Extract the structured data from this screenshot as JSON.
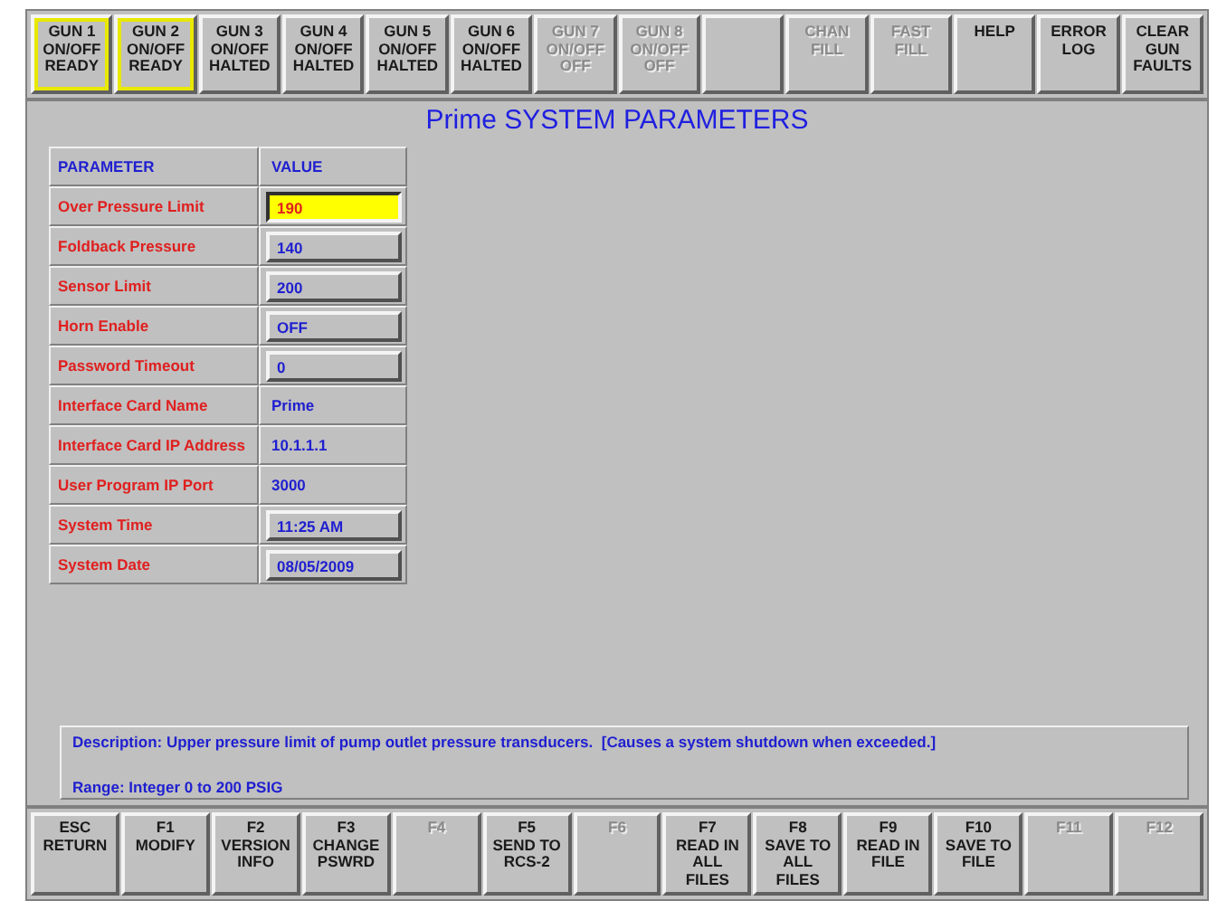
{
  "top_buttons": [
    {
      "lines": [
        "GUN 1",
        "ON/OFF",
        "READY"
      ],
      "highlighted": true,
      "disabled": false
    },
    {
      "lines": [
        "GUN 2",
        "ON/OFF",
        "READY"
      ],
      "highlighted": true,
      "disabled": false
    },
    {
      "lines": [
        "GUN 3",
        "ON/OFF",
        "HALTED"
      ],
      "highlighted": false,
      "disabled": false
    },
    {
      "lines": [
        "GUN 4",
        "ON/OFF",
        "HALTED"
      ],
      "highlighted": false,
      "disabled": false
    },
    {
      "lines": [
        "GUN 5",
        "ON/OFF",
        "HALTED"
      ],
      "highlighted": false,
      "disabled": false
    },
    {
      "lines": [
        "GUN 6",
        "ON/OFF",
        "HALTED"
      ],
      "highlighted": false,
      "disabled": false
    },
    {
      "lines": [
        "GUN 7",
        "ON/OFF",
        "OFF"
      ],
      "highlighted": false,
      "disabled": true
    },
    {
      "lines": [
        "GUN 8",
        "ON/OFF",
        "OFF"
      ],
      "highlighted": false,
      "disabled": true
    },
    {
      "highlighted": false
    },
    {
      "lines": [
        "CHAN",
        "FILL"
      ],
      "highlighted": false,
      "disabled": true
    },
    {
      "lines": [
        "FAST",
        "FILL"
      ],
      "highlighted": false,
      "disabled": true
    },
    {
      "lines": [
        "HELP"
      ],
      "highlighted": false,
      "disabled": false
    },
    {
      "lines": [
        "ERROR",
        "LOG"
      ],
      "highlighted": false,
      "disabled": false
    },
    {
      "lines": [
        "CLEAR",
        "GUN",
        "FAULTS"
      ],
      "highlighted": false,
      "disabled": false
    }
  ],
  "title": "Prime SYSTEM PARAMETERS",
  "table": {
    "columns": [
      "PARAMETER",
      "VALUE"
    ],
    "rows": [
      {
        "parameter": "Over Pressure Limit",
        "value": "190",
        "editable": true,
        "selected": true
      },
      {
        "parameter": "Foldback Pressure",
        "value": "140",
        "editable": true,
        "selected": false
      },
      {
        "parameter": "Sensor Limit",
        "value": "200",
        "editable": true,
        "selected": false
      },
      {
        "parameter": "Horn Enable",
        "value": "OFF",
        "editable": true,
        "selected": false
      },
      {
        "parameter": "Password Timeout",
        "value": "0",
        "editable": true,
        "selected": false
      },
      {
        "parameter": "Interface Card Name",
        "value": "Prime",
        "editable": false,
        "selected": false
      },
      {
        "parameter": "Interface Card IP Address",
        "value": "10.1.1.1",
        "editable": false,
        "selected": false
      },
      {
        "parameter": "User Program IP Port",
        "value": "3000",
        "editable": false,
        "selected": false
      },
      {
        "parameter": "System Time",
        "value": "11:25 AM",
        "editable": true,
        "selected": false
      },
      {
        "parameter": "System Date",
        "value": "08/05/2009",
        "editable": true,
        "selected": false
      }
    ]
  },
  "description": "Description: Upper pressure limit of pump outlet pressure transducers.  [Causes a system shutdown when exceeded.]",
  "range": "Range: Integer 0 to 200 PSIG",
  "bottom_buttons": [
    {
      "lines": [
        "ESC",
        "RETURN"
      ],
      "disabled": false
    },
    {
      "lines": [
        "F1",
        "MODIFY"
      ],
      "disabled": false
    },
    {
      "lines": [
        "F2",
        "VERSION",
        "INFO"
      ],
      "disabled": false
    },
    {
      "lines": [
        "F3",
        "CHANGE",
        "PSWRD"
      ],
      "disabled": false
    },
    {
      "lines": [
        "F4"
      ],
      "disabled": true
    },
    {
      "lines": [
        "F5",
        "SEND TO",
        "RCS-2"
      ],
      "disabled": false
    },
    {
      "lines": [
        "F6"
      ],
      "disabled": true
    },
    {
      "lines": [
        "F7",
        "READ IN",
        "ALL",
        "FILES"
      ],
      "disabled": false
    },
    {
      "lines": [
        "F8",
        "SAVE TO",
        "ALL",
        "FILES"
      ],
      "disabled": false
    },
    {
      "lines": [
        "F9",
        "READ IN",
        "FILE"
      ],
      "disabled": false
    },
    {
      "lines": [
        "F10",
        "SAVE TO",
        "FILE"
      ],
      "disabled": false
    },
    {
      "lines": [
        "F11"
      ],
      "disabled": true
    },
    {
      "lines": [
        "F12"
      ],
      "disabled": true
    }
  ]
}
